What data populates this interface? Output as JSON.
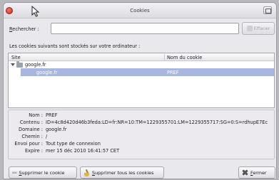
{
  "window": {
    "title": "Cookies"
  },
  "search": {
    "label_underline": "R",
    "label_rest": "echercher :",
    "value": "",
    "clear_label": "Effacer"
  },
  "description": "Les cookies suivants sont stockés sur votre ordinateur :",
  "tree": {
    "columns": {
      "site": "Site",
      "name": "Nom du cookie"
    },
    "parent": {
      "label": "google.fr"
    },
    "selected": {
      "site": "google.fr",
      "name": "PREF"
    }
  },
  "details": {
    "name_key": "Nom :",
    "name_val": "PREF",
    "content_key": "Contenu :",
    "content_val": "ID=4c8d420d46b3feda:LD=fr:NR=10:TM=1229355701:LM=1229355717:SG=0:S=rdhupE7Ec",
    "domain_key": "Domaine :",
    "domain_val": "google.fr",
    "path_key": "Chemin :",
    "path_val": "/",
    "send_key": "Envoi pour :",
    "send_val": "Tout type de connexion",
    "expires_key": "Expire :",
    "expires_val": "mer 15 déc 2010 16:41:57 CET"
  },
  "buttons": {
    "remove_icon": "ooo",
    "remove_underline": "S",
    "remove_rest": "upprimer le cookie",
    "remove_all_underline": "S",
    "remove_all_rest": "upprimer tous les cookies",
    "close_underline": "F",
    "close_rest": "ermer"
  }
}
